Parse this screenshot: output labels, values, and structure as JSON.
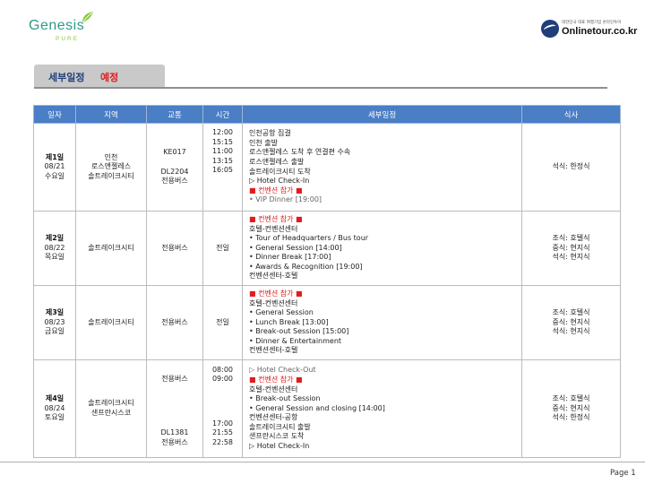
{
  "header": {
    "genesis_word": "Genesis",
    "genesis_sub": "PURE",
    "onlinetour_small": "대한민국 대표 여행기업 온라인투어",
    "onlinetour_big": "Onlinetour.co.kr"
  },
  "section": {
    "title": "세부일정",
    "status": "예정"
  },
  "table": {
    "headers": [
      "일자",
      "지역",
      "교통",
      "시간",
      "세부일정",
      "식사"
    ],
    "rows": [
      {
        "day": "제1일",
        "date": "08/21",
        "weekday": "수요일",
        "region": [
          "인천",
          "로스앤젤레스",
          "솔트레이크시티"
        ],
        "transport_top": [
          "KE017",
          ""
        ],
        "transport_bottom": [
          "DL2204",
          "전용버스"
        ],
        "times": [
          "12:00",
          "15:15",
          "11:00",
          "13:15",
          "16:05"
        ],
        "details": [
          "인천공항 집결",
          "인천 출발",
          "로스앤젤레스 도착 후 연결편 수속",
          "로스앤젤레스 출발",
          "솔트레이크시티 도착",
          "▷ Hotel Check-In"
        ],
        "convention": "■ 컨벤션 참가 ■",
        "after": [
          "• VIP Dinner [19:00]"
        ],
        "meals": [
          "석식: 한정식"
        ]
      },
      {
        "day": "제2일",
        "date": "08/22",
        "weekday": "목요일",
        "region": [
          "솔트레이크시티"
        ],
        "transport": "전용버스",
        "time": "전일",
        "convention": "■ 컨벤션 참가 ■",
        "details": [
          "호텔-컨벤션센터",
          "• Tour of Headquarters / Bus tour",
          "• General Session [14:00]",
          "• Dinner Break [17:00]",
          "• Awards & Recognition [19:00]",
          "컨벤션센터-호텔"
        ],
        "meals": [
          "조식: 호텔식",
          "중식: 현지식",
          "석식: 현지식"
        ]
      },
      {
        "day": "제3일",
        "date": "08/23",
        "weekday": "금요일",
        "region": [
          "솔트레이크시티"
        ],
        "transport": "전용버스",
        "time": "전일",
        "convention": "■ 컨벤션 참가 ■",
        "details": [
          "호텔-컨벤션센터",
          "• General Session",
          "• Lunch Break [13:00]",
          "• Break-out Session [15:00]",
          "• Dinner & Entertainment",
          "컨벤션센터-호텔"
        ],
        "meals": [
          "조식: 호텔식",
          "중식: 현지식",
          "석식: 현지식"
        ]
      },
      {
        "day": "제4일",
        "date": "08/24",
        "weekday": "토요일",
        "region": [
          "솔트레이크시티",
          "샌프란시스코"
        ],
        "transport_top": "전용버스",
        "transport_bottom": [
          "DL1381",
          "전용버스"
        ],
        "times_top": [
          "08:00",
          "09:00"
        ],
        "times_bottom": [
          "17:00",
          "21:55",
          "22:58"
        ],
        "before": [
          "▷ Hotel Check-Out"
        ],
        "convention": "■ 컨벤션 참가 ■",
        "details": [
          "호텔-컨벤션센터",
          "• Break-out Session",
          "• General Session and closing [14:00]",
          "컨벤션센터-공항",
          "솔트레이크시티 출발",
          "샌프란시스코 도착",
          "▷ Hotel Check-In"
        ],
        "meals": [
          "조식: 호텔식",
          "중식: 현지식",
          "석식: 한정식"
        ]
      }
    ]
  },
  "footer": {
    "page": "Page 1"
  },
  "colors": {
    "header_blue": "#4a7ec5",
    "title_navy": "#1f3e7a",
    "accent_red": "#e01d1d",
    "brand_green": "#2d9a86"
  }
}
